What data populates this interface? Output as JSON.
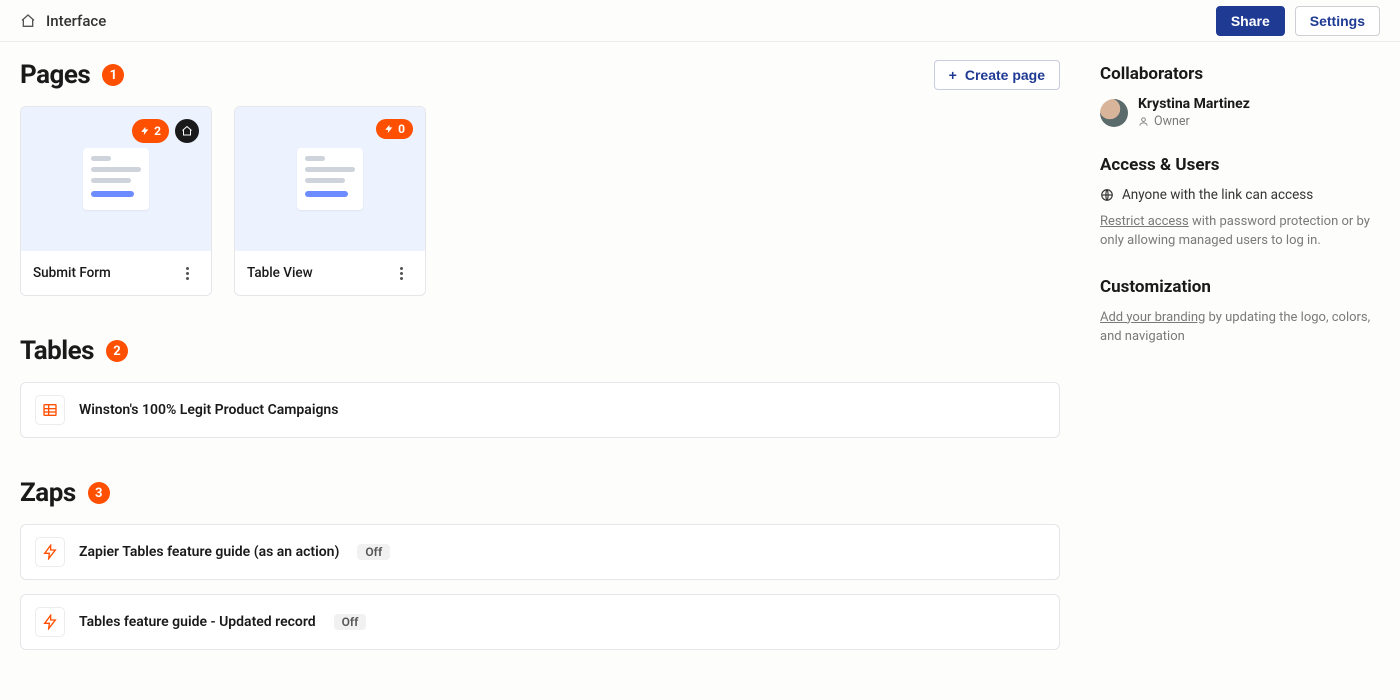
{
  "header": {
    "title": "Interface",
    "share_label": "Share",
    "settings_label": "Settings"
  },
  "sections": {
    "pages": {
      "title": "Pages",
      "count": "1",
      "create_label": "Create page"
    },
    "tables": {
      "title": "Tables",
      "count": "2"
    },
    "zaps": {
      "title": "Zaps",
      "count": "3"
    }
  },
  "pages": [
    {
      "name": "Submit Form",
      "zap_count": "2",
      "is_home": true
    },
    {
      "name": "Table View",
      "zap_count": "0",
      "is_home": false
    }
  ],
  "tables": [
    {
      "name": "Winston's 100% Legit Product Campaigns"
    }
  ],
  "zaps": [
    {
      "name": "Zapier Tables feature guide (as an action)",
      "status": "Off"
    },
    {
      "name": "Tables feature guide - Updated record",
      "status": "Off"
    }
  ],
  "sidebar": {
    "collaborators": {
      "title": "Collaborators",
      "user_name": "Krystina Martinez",
      "user_role": "Owner"
    },
    "access": {
      "title": "Access & Users",
      "public_text": "Anyone with the link can access",
      "restrict_link": "Restrict access",
      "restrict_rest": " with password protection or by only allowing managed users to log in."
    },
    "customization": {
      "title": "Customization",
      "branding_link": "Add your branding",
      "branding_rest": " by updating the logo, colors, and navigation"
    }
  }
}
